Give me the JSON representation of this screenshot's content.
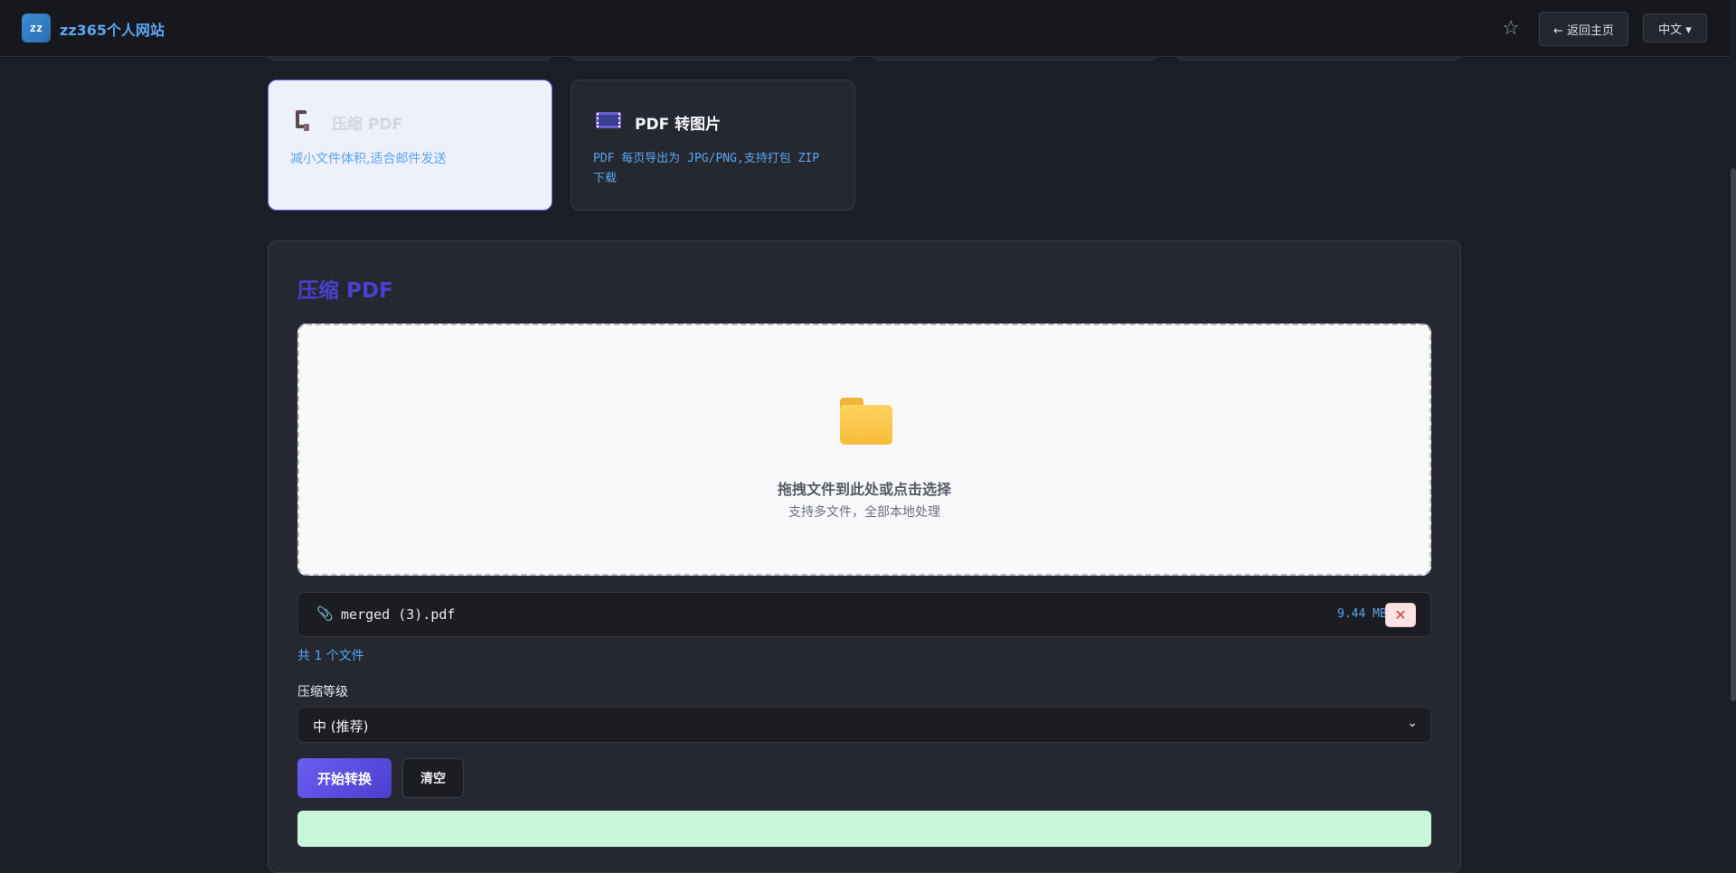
{
  "header": {
    "logo_text": "zz",
    "site_title": "zz365个人网站",
    "star_icon": "☆",
    "home_label": "← 返回主页",
    "lang_label": "中文 ▾"
  },
  "tools": [
    {
      "icon": "clamp-icon",
      "title": "压缩 PDF",
      "desc": "减小文件体积,适合邮件发送",
      "active": true
    },
    {
      "icon": "film-icon",
      "title": "PDF 转图片",
      "desc": "PDF 每页导出为 JPG/PNG,支持打包 ZIP 下载",
      "active": false
    }
  ],
  "panel": {
    "title": "压缩 PDF",
    "dropzone": {
      "main_text": "拖拽文件到此处或点击选择",
      "sub_text": "支持多文件，全部本地处理"
    },
    "files": [
      {
        "name": "merged (3).pdf",
        "size": "9.44 MB"
      }
    ],
    "file_count": "共 1 个文件",
    "level_label": "压缩等级",
    "level_value": "中 (推荐)",
    "start_label": "开始转换",
    "clear_label": "清空"
  },
  "colors": {
    "accent": "#4b3fcf",
    "link": "#5aa6f0",
    "background": "#1b1e25"
  }
}
